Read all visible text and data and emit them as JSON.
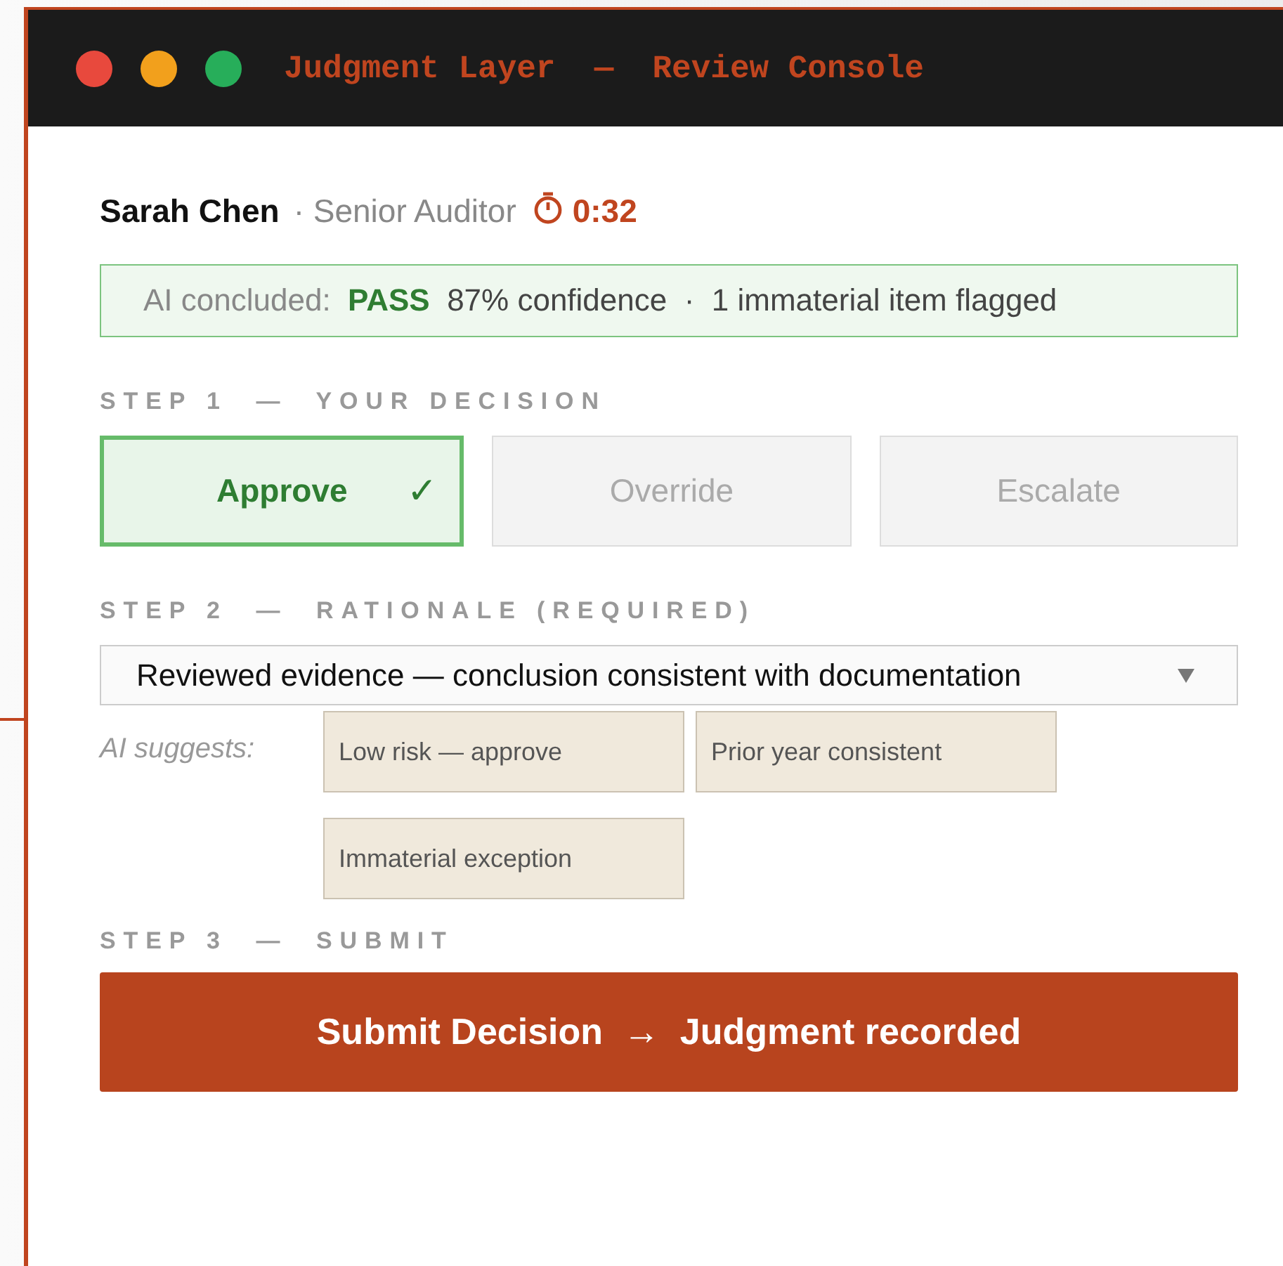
{
  "window": {
    "title": "Judgment Layer  —  Review Console"
  },
  "reviewer": {
    "name": "Sarah Chen",
    "role": "· Senior Auditor",
    "timer": "0:32"
  },
  "ai_banner": {
    "label": "AI concluded:",
    "verdict": "PASS",
    "detail": "87% confidence  ·  1 immaterial item flagged"
  },
  "step1": {
    "label": "STEP 1  —  YOUR DECISION",
    "check_mark": "✓",
    "options": [
      {
        "label": "Approve",
        "selected": true
      },
      {
        "label": "Override",
        "selected": false
      },
      {
        "label": "Escalate",
        "selected": false
      }
    ]
  },
  "step2": {
    "label": "STEP 2  —  RATIONALE (REQUIRED)",
    "rationale": {
      "value": "Reviewed evidence — conclusion consistent with documentation"
    },
    "suggestions_label": "AI suggests:",
    "suggestions": [
      "Low risk — approve",
      "Prior year consistent",
      "Immaterial exception"
    ]
  },
  "step3": {
    "label": "STEP 3  —  SUBMIT",
    "submit_button": "Submit Decision  →  Judgment recorded"
  }
}
